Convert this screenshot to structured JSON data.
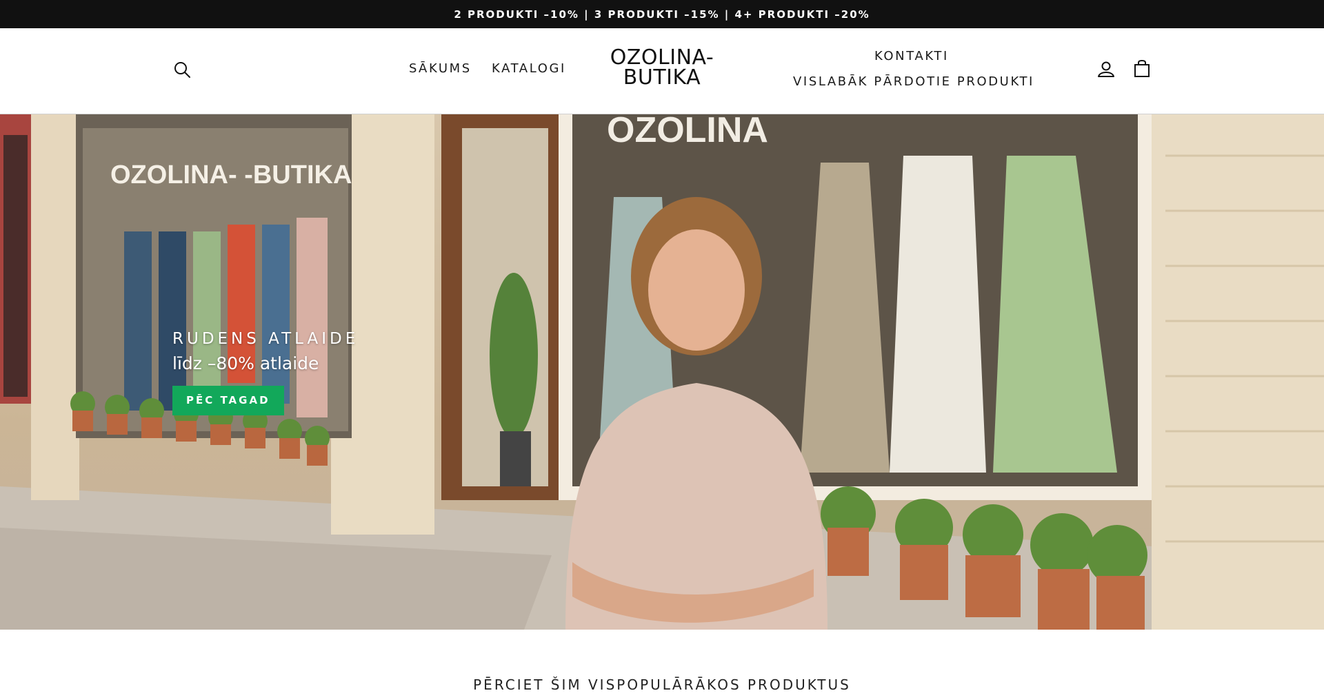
{
  "announcement": {
    "text": "2 PRODUKTI –10% | 3 PRODUKTI –15% | 4+ PRODUKTI –20%"
  },
  "header": {
    "logo_line1": "OZOLINA-",
    "logo_line2": "BUTIKA",
    "nav_left": [
      {
        "label": "SĀKUMS"
      },
      {
        "label": "KATALOGI"
      }
    ],
    "nav_right": [
      {
        "label": "KONTAKTI"
      },
      {
        "label": "VISLABĀK PĀRDOTIE PRODUKTI"
      }
    ],
    "icons": {
      "search": "search-icon",
      "account": "user-icon",
      "cart": "bag-icon"
    }
  },
  "hero": {
    "subtitle": "RUDENS ATLAIDE",
    "title": "līdz –80% atlaide",
    "cta_label": "PĒC TAGAD",
    "cta_color": "#12a85a",
    "image_sign_text": "OZOLINA- -BUTIKA",
    "image_window_text": "OZOLINA"
  },
  "section": {
    "heading": "PĒRCIET ŠIM VISPOPULĀRĀKOS PRODUKTUS"
  }
}
